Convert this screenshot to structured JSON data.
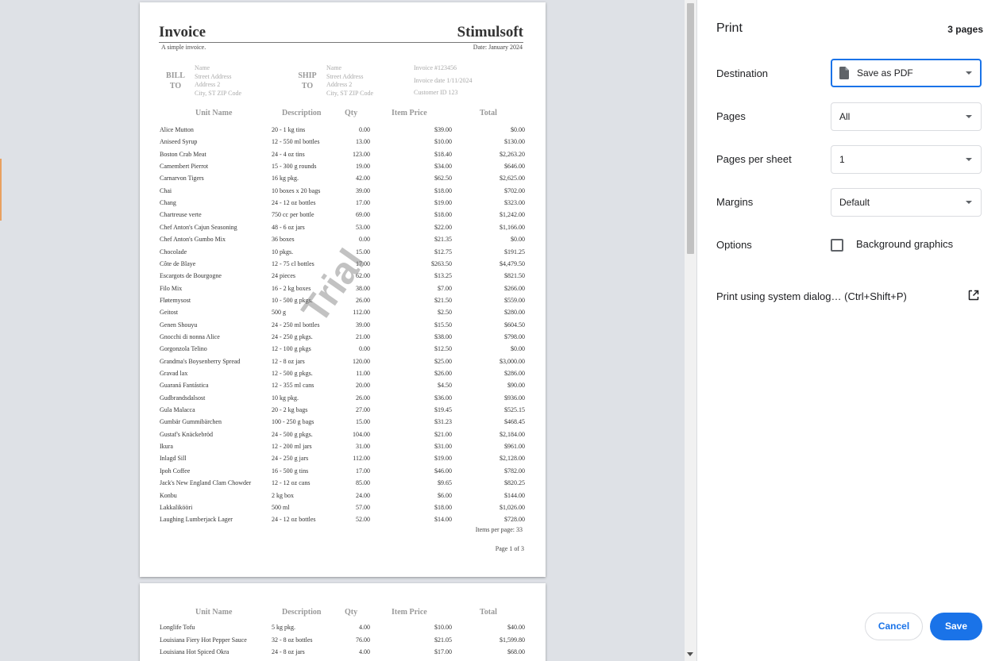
{
  "invoice": {
    "title": "Invoice",
    "brand": "Stimulsoft",
    "subtitle": "A simple invoice.",
    "date": "Date: January 2024",
    "bill_to": "BILL\nTO",
    "ship_to": "SHIP\nTO",
    "bill_address": [
      "Name",
      "Street Address",
      "Address 2",
      "City, ST  ZIP Code"
    ],
    "ship_address": [
      "Name",
      "Street Address",
      "Address 2",
      "City, ST  ZIP Code"
    ],
    "meta": [
      "Invoice #123456",
      "Invoice date 1/11/2024",
      "Customer ID 123"
    ],
    "columns": [
      "Unit Name",
      "Description",
      "Qty",
      "Item Price",
      "Total"
    ],
    "rows": [
      [
        "Alice Mutton",
        "20 - 1 kg tins",
        "0.00",
        "$39.00",
        "$0.00"
      ],
      [
        "Aniseed Syrup",
        "12 - 550 ml bottles",
        "13.00",
        "$10.00",
        "$130.00"
      ],
      [
        "Boston Crab Meat",
        "24 - 4 oz tins",
        "123.00",
        "$18.40",
        "$2,263.20"
      ],
      [
        "Camembert Pierrot",
        "15 - 300 g rounds",
        "19.00",
        "$34.00",
        "$646.00"
      ],
      [
        "Carnarvon Tigers",
        "16 kg pkg.",
        "42.00",
        "$62.50",
        "$2,625.00"
      ],
      [
        "Chai",
        "10 boxes x 20 bags",
        "39.00",
        "$18.00",
        "$702.00"
      ],
      [
        "Chang",
        "24 - 12 oz bottles",
        "17.00",
        "$19.00",
        "$323.00"
      ],
      [
        "Chartreuse verte",
        "750 cc per bottle",
        "69.00",
        "$18.00",
        "$1,242.00"
      ],
      [
        "Chef Anton's Cajun Seasoning",
        "48 - 6 oz jars",
        "53.00",
        "$22.00",
        "$1,166.00"
      ],
      [
        "Chef Anton's Gumbo Mix",
        "36 boxes",
        "0.00",
        "$21.35",
        "$0.00"
      ],
      [
        "Chocolade",
        "10 pkgs.",
        "15.00",
        "$12.75",
        "$191.25"
      ],
      [
        "Côte de Blaye",
        "12 - 75 cl bottles",
        "17.00",
        "$263.50",
        "$4,479.50"
      ],
      [
        "Escargots de Bourgogne",
        "24 pieces",
        "62.00",
        "$13.25",
        "$821.50"
      ],
      [
        "Filo Mix",
        "16 - 2 kg boxes",
        "38.00",
        "$7.00",
        "$266.00"
      ],
      [
        "Fløtemysost",
        "10 - 500 g pkgs.",
        "26.00",
        "$21.50",
        "$559.00"
      ],
      [
        "Geitost",
        "500 g",
        "112.00",
        "$2.50",
        "$280.00"
      ],
      [
        "Genen Shouyu",
        "24 - 250 ml bottles",
        "39.00",
        "$15.50",
        "$604.50"
      ],
      [
        "Gnocchi di nonna Alice",
        "24 - 250 g pkgs.",
        "21.00",
        "$38.00",
        "$798.00"
      ],
      [
        "Gorgonzola Telino",
        "12 - 100 g pkgs",
        "0.00",
        "$12.50",
        "$0.00"
      ],
      [
        "Grandma's Boysenberry Spread",
        "12 - 8 oz jars",
        "120.00",
        "$25.00",
        "$3,000.00"
      ],
      [
        "Gravad lax",
        "12 - 500 g pkgs.",
        "11.00",
        "$26.00",
        "$286.00"
      ],
      [
        "Guaraná Fantástica",
        "12 - 355 ml cans",
        "20.00",
        "$4.50",
        "$90.00"
      ],
      [
        "Gudbrandsdalsost",
        "10 kg pkg.",
        "26.00",
        "$36.00",
        "$936.00"
      ],
      [
        "Gula Malacca",
        "20 - 2 kg bags",
        "27.00",
        "$19.45",
        "$525.15"
      ],
      [
        "Gumbär Gummibärchen",
        "100 - 250 g bags",
        "15.00",
        "$31.23",
        "$468.45"
      ],
      [
        "Gustaf's Knäckebröd",
        "24 - 500 g pkgs.",
        "104.00",
        "$21.00",
        "$2,184.00"
      ],
      [
        "Ikura",
        "12 - 200 ml jars",
        "31.00",
        "$31.00",
        "$961.00"
      ],
      [
        "Inlagd Sill",
        "24 - 250 g jars",
        "112.00",
        "$19.00",
        "$2,128.00"
      ],
      [
        "Ipoh Coffee",
        "16 - 500 g tins",
        "17.00",
        "$46.00",
        "$782.00"
      ],
      [
        "Jack's New England Clam Chowder",
        "12 - 12 oz cans",
        "85.00",
        "$9.65",
        "$820.25"
      ],
      [
        "Konbu",
        "2 kg box",
        "24.00",
        "$6.00",
        "$144.00"
      ],
      [
        "Lakkalikööri",
        "500 ml",
        "57.00",
        "$18.00",
        "$1,026.00"
      ],
      [
        "Laughing Lumberjack Lager",
        "24 - 12 oz bottles",
        "52.00",
        "$14.00",
        "$728.00"
      ]
    ],
    "items_per_page": "Items per page: 33",
    "page_number": "Page 1 of 3",
    "watermark": "Trial",
    "page2_rows": [
      [
        "Longlife Tofu",
        "5 kg pkg.",
        "4.00",
        "$10.00",
        "$40.00"
      ],
      [
        "Louisiana Fiery Hot Pepper Sauce",
        "32 - 8 oz bottles",
        "76.00",
        "$21.05",
        "$1,599.80"
      ],
      [
        "Louisiana Hot Spiced Okra",
        "24 - 8 oz jars",
        "4.00",
        "$17.00",
        "$68.00"
      ]
    ]
  },
  "print": {
    "title": "Print",
    "page_count": "3 pages",
    "destination_label": "Destination",
    "destination_value": "Save as PDF",
    "pages_label": "Pages",
    "pages_value": "All",
    "pages_per_sheet_label": "Pages per sheet",
    "pages_per_sheet_value": "1",
    "margins_label": "Margins",
    "margins_value": "Default",
    "options_label": "Options",
    "background_graphics_label": "Background graphics",
    "background_graphics_checked": false,
    "system_dialog_label": "Print using system dialog… (Ctrl+Shift+P)",
    "cancel_label": "Cancel",
    "save_label": "Save",
    "accent_color": "#1a73e8"
  },
  "icons": {
    "destination": "pdf-document-icon",
    "dropdown": "caret-down-icon",
    "system_dialog": "open-external-icon"
  }
}
